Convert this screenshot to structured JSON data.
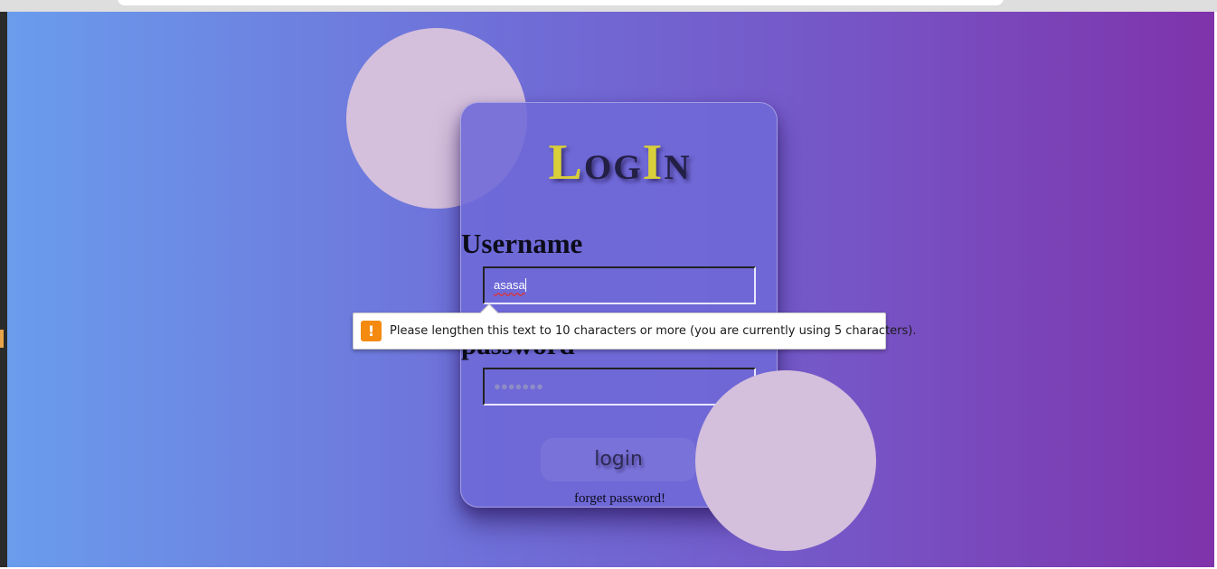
{
  "card": {
    "title_L": "L",
    "title_og": "og",
    "title_I": "I",
    "title_n": "n",
    "username_label": "Username",
    "username_value": "asasa",
    "password_label": "password",
    "password_placeholder": "●●●●●●●",
    "login_button": "login",
    "forgot_link": "forget password!"
  },
  "validation": {
    "icon": "!",
    "message": "Please lengthen this text to 10 characters or more (you are currently using 5 characters)."
  },
  "colors": {
    "gradient_start": "#6a9cec",
    "gradient_end": "#7f33ab",
    "title_highlight": "#d8cf3a",
    "warning": "#f48a10"
  }
}
